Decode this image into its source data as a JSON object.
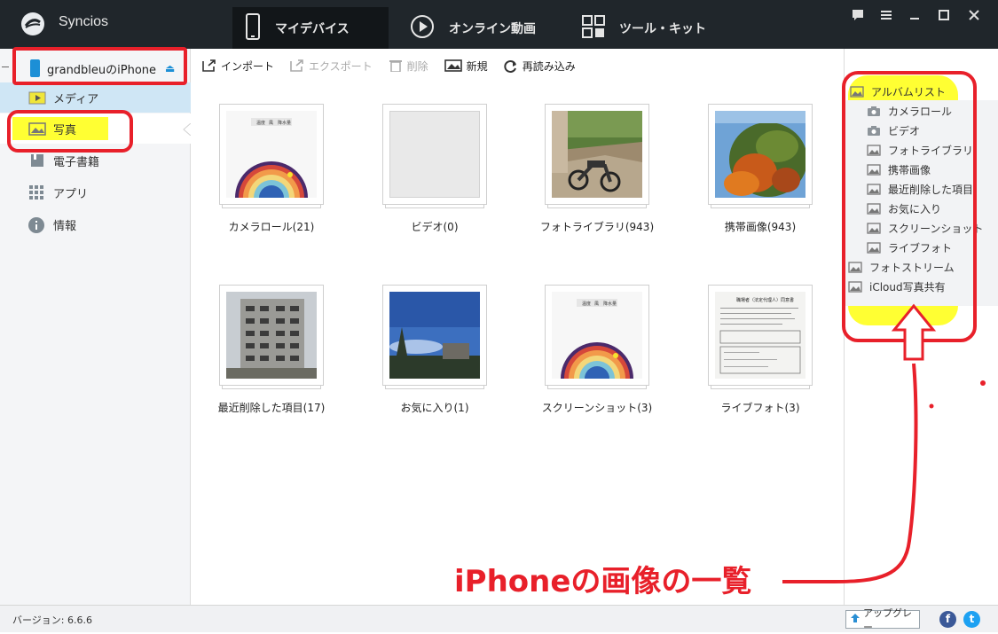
{
  "titlebar": {
    "app_name": "Syncios",
    "tabs": [
      {
        "label": "マイデバイス",
        "icon": "phone-icon",
        "active": true
      },
      {
        "label": "オンライン動画",
        "icon": "play-icon",
        "active": false
      },
      {
        "label": "ツール・キット",
        "icon": "toolkit-icon",
        "active": false
      }
    ],
    "window_controls": [
      "chat-icon",
      "menu-icon",
      "minimize-icon",
      "maximize-icon",
      "close-icon"
    ]
  },
  "sidebar": {
    "device_name": "grandbleuのiPhone",
    "eject": "⏏",
    "items": [
      {
        "label": "メディア",
        "icon": "media-icon"
      },
      {
        "label": "写真",
        "icon": "photo-icon"
      },
      {
        "label": "電子書籍",
        "icon": "ebook-icon"
      },
      {
        "label": "アプリ",
        "icon": "apps-icon"
      },
      {
        "label": "情報",
        "icon": "info-icon"
      }
    ]
  },
  "toolbar": {
    "import": "インポート",
    "export": "エクスポート",
    "delete": "削除",
    "new": "新規",
    "reload": "再読み込み"
  },
  "albums": [
    {
      "label": "カメラロール(21)",
      "thumb": "chart"
    },
    {
      "label": "ビデオ(0)",
      "thumb": "empty"
    },
    {
      "label": "フォトライブラリ(943)",
      "thumb": "motorbike"
    },
    {
      "label": "携帯画像(943)",
      "thumb": "autumn"
    },
    {
      "label": "最近削除した項目(17)",
      "thumb": "building"
    },
    {
      "label": "お気に入り(1)",
      "thumb": "sky"
    },
    {
      "label": "スクリーンショット(3)",
      "thumb": "chart"
    },
    {
      "label": "ライブフォト(3)",
      "thumb": "document"
    }
  ],
  "chart_thumb_tabs": [
    "温度",
    "風",
    "降水量"
  ],
  "document_thumb_title": "職場者（法定代理人）同意書",
  "right_panel": {
    "root": "アルバムリスト",
    "children": [
      {
        "label": "カメラロール",
        "icon": "camera-icon"
      },
      {
        "label": "ビデオ",
        "icon": "camera-icon"
      },
      {
        "label": "フォトライブラリ",
        "icon": "image-icon"
      },
      {
        "label": "携帯画像",
        "icon": "image-icon"
      },
      {
        "label": "最近削除した項目",
        "icon": "image-icon"
      },
      {
        "label": "お気に入り",
        "icon": "image-icon"
      },
      {
        "label": "スクリーンショット",
        "icon": "image-icon"
      },
      {
        "label": "ライブフォト",
        "icon": "image-icon"
      }
    ],
    "photostream": "フォトストリーム",
    "icloud": "iCloud写真共有"
  },
  "statusbar": {
    "version": "バージョン: 6.6.6",
    "upgrade": "アップグレー",
    "facebook": "f",
    "twitter": "t"
  },
  "annotation": {
    "caption": "iPhoneの画像の一覧",
    "color": "#e8202a",
    "highlight": "#ffff33"
  }
}
